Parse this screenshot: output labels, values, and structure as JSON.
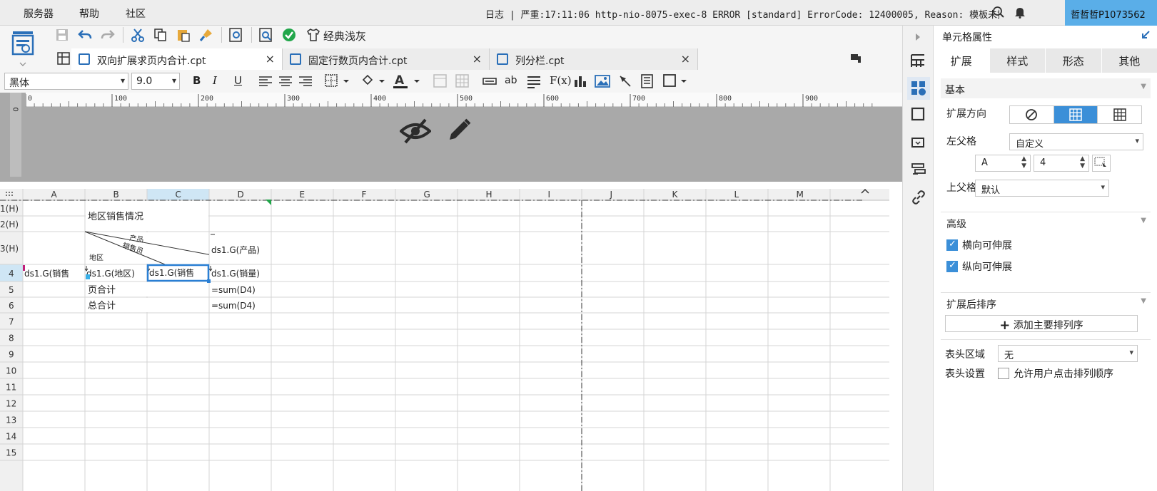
{
  "menubar": {
    "items": [
      "服务器",
      "帮助",
      "社区"
    ],
    "log_label": "日志",
    "log_text": "| 严重:17:11:06 http-nio-8075-exec-8 ERROR [standard] ErrorCode: 12400005, Reason: 模板未操...",
    "user": "哲哲哲P1073562"
  },
  "toolbar": {
    "theme_label": "经典浅灰",
    "accent": "#2a6fb8",
    "ok_color": "#21a64a"
  },
  "tabs": [
    {
      "label": "双向扩展求页内合计.cpt"
    },
    {
      "label": "固定行数页内合计.cpt"
    },
    {
      "label": "列分栏.cpt"
    }
  ],
  "format": {
    "font_name": "黑体",
    "font_size": "9.0",
    "bold": "B",
    "italic": "I",
    "underline": "U",
    "fx": "F(x)",
    "ab": "ab"
  },
  "ruler": {
    "marks": [
      "0",
      "100",
      "200",
      "300",
      "400",
      "500",
      "600",
      "700",
      "800",
      "900"
    ],
    "v_mark": "0"
  },
  "grid": {
    "columns": [
      "A",
      "B",
      "C",
      "D",
      "E",
      "F",
      "G",
      "H",
      "I",
      "J",
      "K",
      "L",
      "M"
    ],
    "rows": [
      "1(H)",
      "2(H)",
      "3(H)",
      "4",
      "5",
      "6",
      "7",
      "8",
      "9",
      "10",
      "11",
      "12",
      "13",
      "14",
      "15"
    ],
    "selected_col": "C",
    "selected_row": "4",
    "cells": {
      "title": "地区销售情况",
      "diag_product": "产品",
      "diag_sales": "销售员",
      "diag_region": "地区",
      "d3": "ds1.G(产品)",
      "a4": "ds1.G(销售",
      "b4": "ds1.G(地区)",
      "c4": "ds1.G(销售",
      "d4": "ds1.G(销量)",
      "b5": "页合计",
      "d5": "=sum(D4)",
      "b6": "总合计",
      "d6": "=sum(D4)"
    }
  },
  "panel": {
    "title": "单元格属性",
    "tabs": [
      "扩展",
      "样式",
      "形态",
      "其他"
    ],
    "basic": "基本",
    "expand_dir": "扩展方向",
    "left_parent": "左父格",
    "left_parent_value": "自定义",
    "left_col": "A",
    "left_row": "4",
    "up_parent": "上父格",
    "up_parent_value": "默认",
    "advanced": "高级",
    "h_expand": "横向可伸展",
    "v_expand": "纵向可伸展",
    "sort_after": "扩展后排序",
    "add_sort": "添加主要排列序",
    "header_area": "表头区域",
    "header_area_value": "无",
    "header_setting": "表头设置",
    "allow_sort": "允许用户点击排列顺序"
  }
}
